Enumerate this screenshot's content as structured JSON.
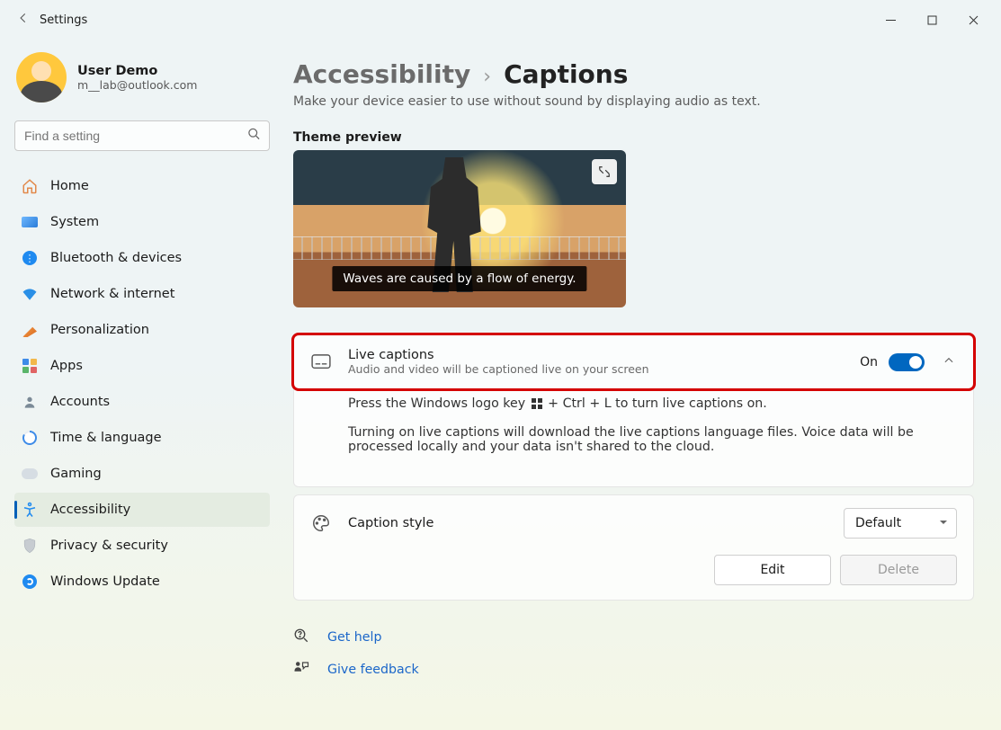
{
  "window": {
    "title": "Settings"
  },
  "user": {
    "name": "User Demo",
    "email": "m__lab@outlook.com"
  },
  "search": {
    "placeholder": "Find a setting"
  },
  "nav": {
    "home": "Home",
    "system": "System",
    "bluetooth": "Bluetooth & devices",
    "network": "Network & internet",
    "personalization": "Personalization",
    "apps": "Apps",
    "accounts": "Accounts",
    "time": "Time & language",
    "gaming": "Gaming",
    "accessibility": "Accessibility",
    "privacy": "Privacy & security",
    "update": "Windows Update"
  },
  "crumb": {
    "parent": "Accessibility",
    "sep": "›",
    "current": "Captions"
  },
  "description": "Make your device easier to use without sound by displaying audio as text.",
  "preview": {
    "label": "Theme preview",
    "caption_text": "Waves are caused by a flow of energy."
  },
  "live_captions": {
    "title": "Live captions",
    "subtitle": "Audio and video will be captioned live on your screen",
    "state_label": "On",
    "hint_pre": "Press the Windows logo key ",
    "hint_post": " + Ctrl + L to turn live captions on.",
    "body2": "Turning on live captions will download the live captions language files. Voice data will be processed locally and your data isn't shared to the cloud."
  },
  "caption_style": {
    "title": "Caption style",
    "selected": "Default",
    "edit": "Edit",
    "delete": "Delete"
  },
  "links": {
    "help": "Get help",
    "feedback": "Give feedback"
  }
}
